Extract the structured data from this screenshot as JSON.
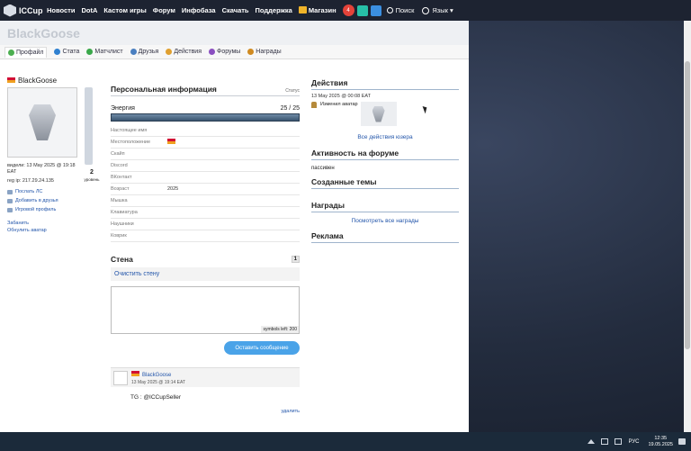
{
  "nav": {
    "brand": "ICCup",
    "items": [
      "Новости",
      "DotA",
      "Кастом игры",
      "Форум",
      "Инфобаза",
      "Скачать",
      "Поддержка"
    ],
    "shop": "Магазин",
    "notif_count": "4",
    "search": "Поиск",
    "language": "Язык"
  },
  "profile": {
    "title": "BlackGoose",
    "tabs": [
      "Профайл",
      "Стата",
      "Матчлист",
      "Друзья",
      "Действия",
      "Форумы",
      "Награды"
    ],
    "name": "BlackGoose",
    "seen": "видели: 13 May 2025 @ 19:18 EAT",
    "reg_ip": "reg ip: 217.29.24.135",
    "level": "2",
    "level_label": "уровень",
    "links": [
      "Послать ЛС",
      "Добавить в друзья",
      "Игровой профиль"
    ],
    "extra_links": [
      "Забанить",
      "Обнулить аватар"
    ]
  },
  "personal": {
    "title": "Персональная информация",
    "status_label": "Статус",
    "energy_label": "Энергия",
    "energy_value": "25 / 25",
    "energy_fraction": 1.0,
    "rows": [
      {
        "label": "Настоящее имя",
        "value": ""
      },
      {
        "label": "Местоположение",
        "value": ""
      },
      {
        "label": "Скайп",
        "value": ""
      },
      {
        "label": "Discord",
        "value": ""
      },
      {
        "label": "ВКонтакт",
        "value": ""
      },
      {
        "label": "Возраст",
        "value": "2025"
      },
      {
        "label": "Мышка",
        "value": ""
      },
      {
        "label": "Клавиатура",
        "value": ""
      },
      {
        "label": "Наушники",
        "value": ""
      },
      {
        "label": "Коврик",
        "value": ""
      }
    ]
  },
  "wall": {
    "title": "Стена",
    "page": "1",
    "clear": "Очистить стену",
    "symbols_left": "symbols left: 200",
    "send": "Оставить сообщение",
    "post_author": "BlackGoose",
    "post_date": "13 May 2025 @ 19:14 EAT",
    "post_text": "TG : @ICCupSeller",
    "delete": "удалить"
  },
  "right": {
    "actions_title": "Действия",
    "action_date": "13 May 2025 @ 00:08 EAT",
    "action_text": "Изменил аватар",
    "all_actions": "Все действия юзера",
    "forum_title": "Активность на форуме",
    "forum_status": "пассивен",
    "topics_title": "Созданные темы",
    "awards_title": "Награды",
    "all_awards": "Посмотреть все награды",
    "ads_title": "Реклама"
  },
  "taskbar": {
    "lang": "РУС",
    "time": "12:35",
    "date": "19.05.2025"
  }
}
